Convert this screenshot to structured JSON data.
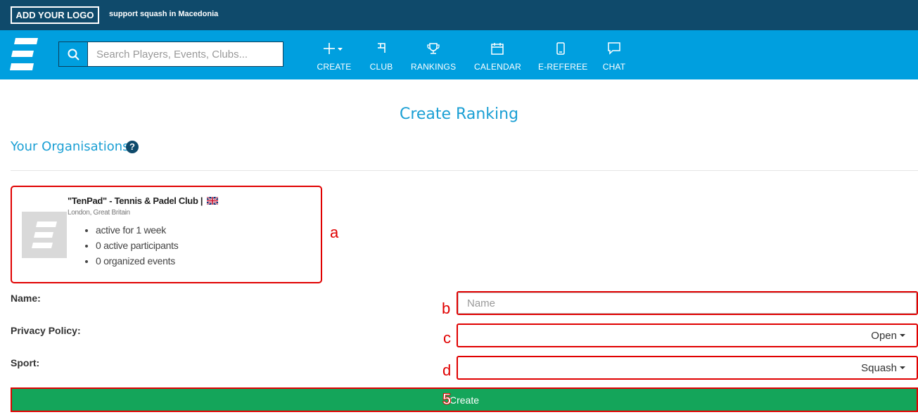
{
  "topbar": {
    "logo_text": "ADD YOUR LOGO",
    "tagline": "support squash in Macedonia"
  },
  "navbar": {
    "search_placeholder": "Search Players, Events, Clubs...",
    "items": [
      {
        "label": "CREATE",
        "icon": "plus-icon"
      },
      {
        "label": "CLUB",
        "icon": "club-icon"
      },
      {
        "label": "RANKINGS",
        "icon": "trophy-icon"
      },
      {
        "label": "CALENDAR",
        "icon": "calendar-icon"
      },
      {
        "label": "E-REFEREE",
        "icon": "mobile-icon"
      },
      {
        "label": "CHAT",
        "icon": "chat-icon"
      }
    ]
  },
  "page": {
    "title": "Create Ranking",
    "organisations_heading": "Your Organisations"
  },
  "organisation": {
    "name": "\"TenPad\" - Tennis & Padel Club |",
    "location": "London, Great Britain",
    "stats": [
      "active for 1 week",
      "0 active participants",
      "0 organized events"
    ]
  },
  "form": {
    "name_label": "Name:",
    "name_placeholder": "Name",
    "privacy_label": "Privacy Policy:",
    "privacy_value": "Open",
    "sport_label": "Sport:",
    "sport_value": "Squash",
    "create_label": "Create"
  },
  "annotations": {
    "a": "a",
    "b": "b",
    "c": "c",
    "d": "d",
    "five": "5"
  },
  "colors": {
    "topbar": "#0f4a6b",
    "navbar": "#009fdf",
    "accent_text": "#1a9fd4",
    "create_button": "#14a55a",
    "annotation_red": "#e00000"
  }
}
